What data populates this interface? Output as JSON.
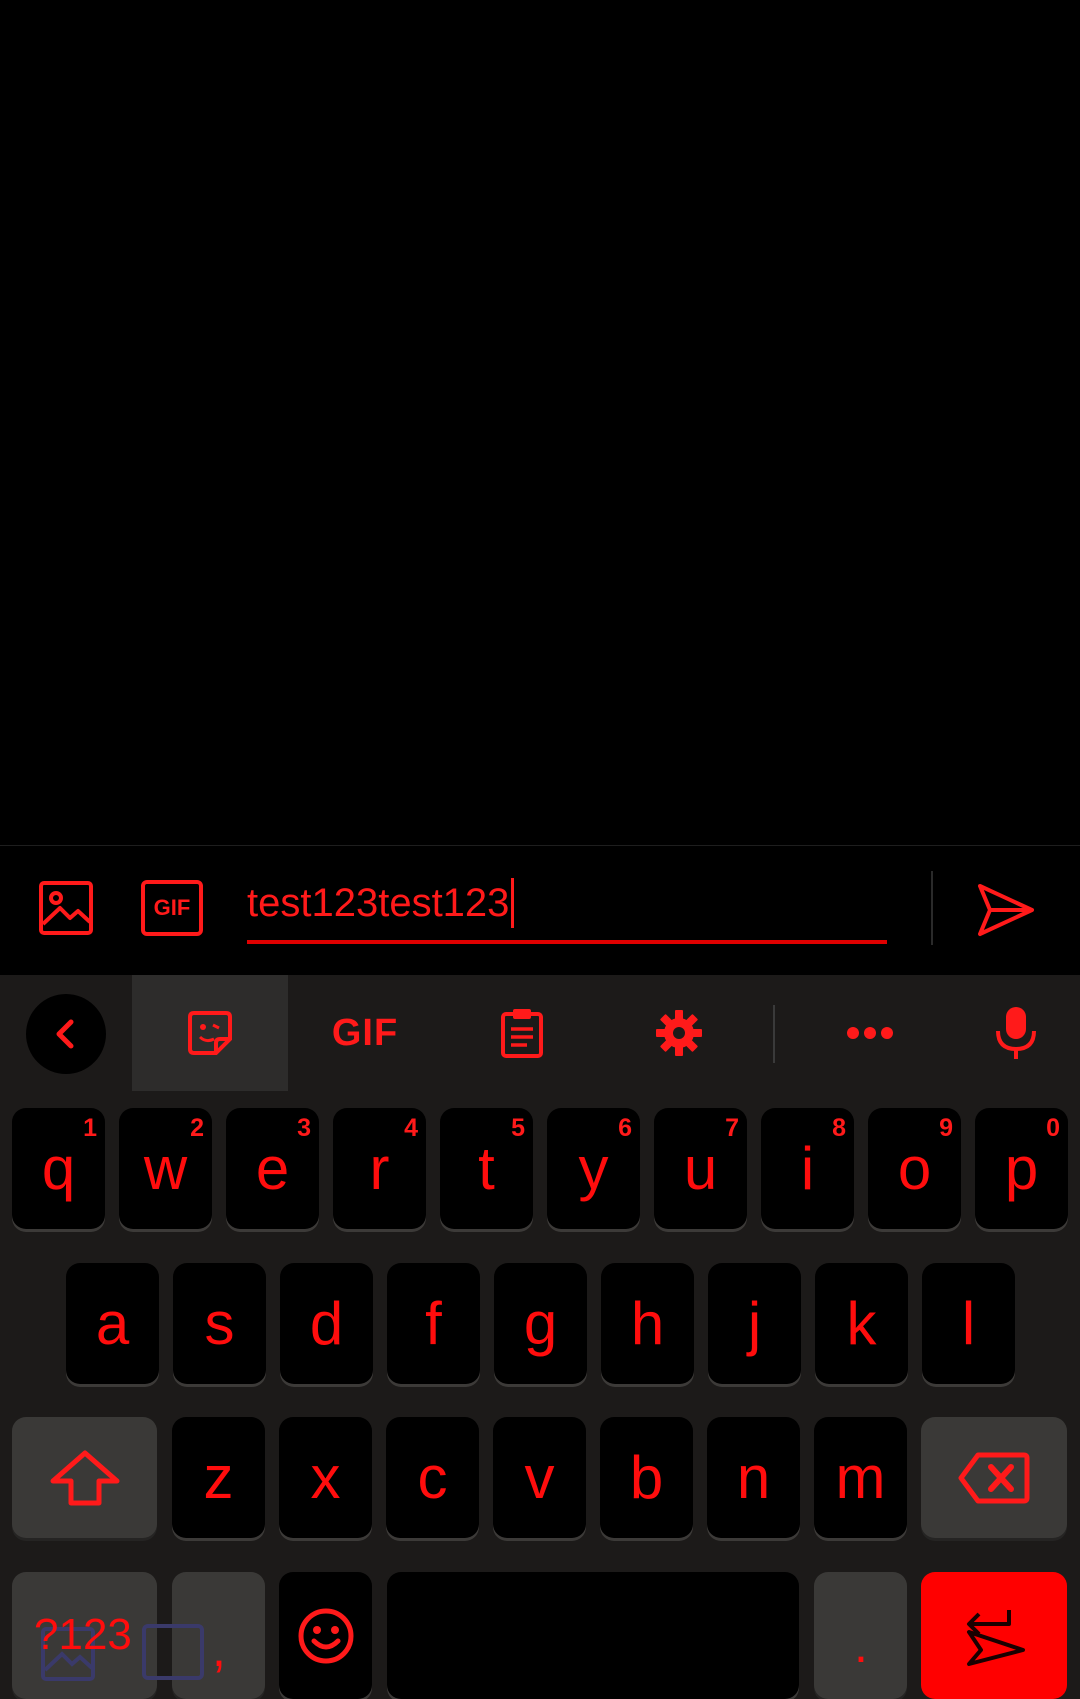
{
  "compose": {
    "image_icon": "image-icon",
    "gif_button": "GIF",
    "input_value": "test123test123",
    "send_icon": "send-icon"
  },
  "toolbar": {
    "back_icon": "chevron-left-icon",
    "sticker_icon": "sticker-icon",
    "gif_label": "GIF",
    "clipboard_icon": "clipboard-icon",
    "settings_icon": "gear-icon",
    "more_icon": "more-icon",
    "mic_icon": "microphone-icon"
  },
  "keys": {
    "row1": [
      {
        "label": "q",
        "hint": "1"
      },
      {
        "label": "w",
        "hint": "2"
      },
      {
        "label": "e",
        "hint": "3"
      },
      {
        "label": "r",
        "hint": "4"
      },
      {
        "label": "t",
        "hint": "5"
      },
      {
        "label": "y",
        "hint": "6"
      },
      {
        "label": "u",
        "hint": "7"
      },
      {
        "label": "i",
        "hint": "8"
      },
      {
        "label": "o",
        "hint": "9"
      },
      {
        "label": "p",
        "hint": "0"
      }
    ],
    "row2": [
      "a",
      "s",
      "d",
      "f",
      "g",
      "h",
      "j",
      "k",
      "l"
    ],
    "row3": [
      "z",
      "x",
      "c",
      "v",
      "b",
      "n",
      "m"
    ],
    "symbols_label": "?123",
    "comma_label": ",",
    "period_label": ".",
    "shift_icon": "shift-icon",
    "backspace_icon": "backspace-icon",
    "emoji_icon": "emoji-icon",
    "enter_icon": "enter-icon"
  },
  "colors": {
    "accent": "#ff0000",
    "keyboard_bg": "#1c1a19",
    "key_bg": "#000000",
    "modifier_bg": "#3a3937"
  }
}
